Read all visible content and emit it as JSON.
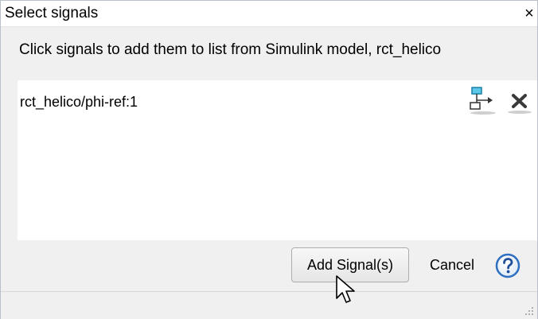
{
  "dialog": {
    "title": "Select signals",
    "close_label": "×",
    "instruction": "Click signals to add them to list from Simulink model, rct_helico"
  },
  "signals": [
    {
      "name": "rct_helico/phi-ref:1",
      "actions": [
        "highlight-signal-icon",
        "remove-icon"
      ]
    }
  ],
  "buttons": {
    "add": "Add Signal(s)",
    "cancel": "Cancel",
    "help_icon": "question-mark-icon"
  },
  "colors": {
    "dialog_bg": "#f0f0f0",
    "list_bg": "#ffffff",
    "help_blue": "#2f6fbf"
  }
}
